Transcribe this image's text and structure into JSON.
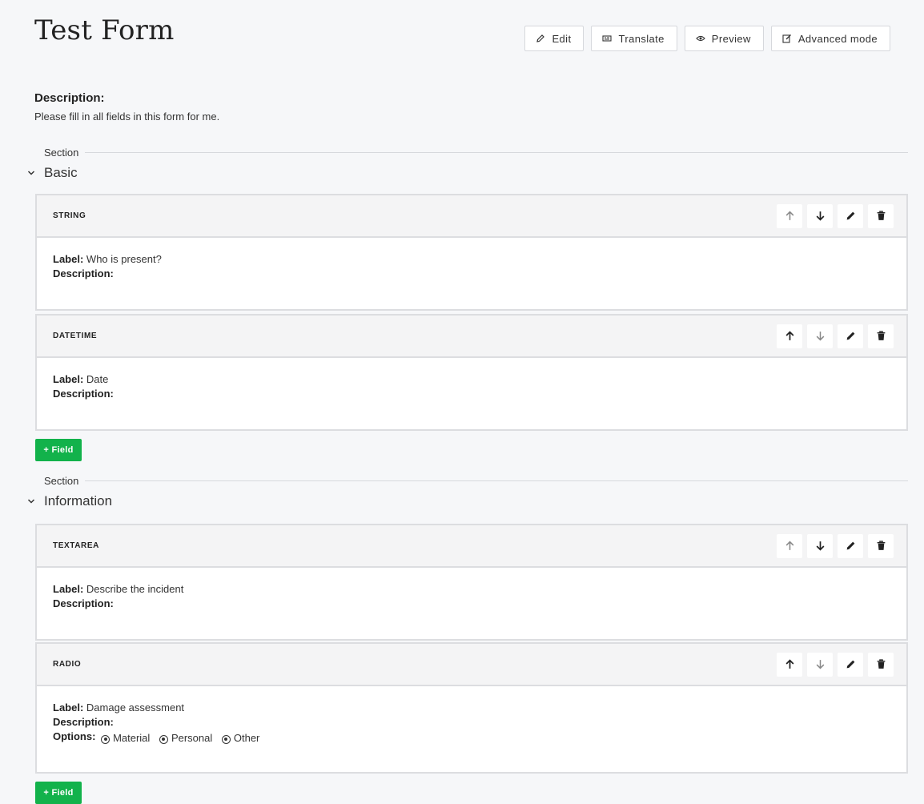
{
  "page": {
    "title": "Test Form",
    "description_heading": "Description:",
    "description_text": "Please fill in all fields in this form for me."
  },
  "toolbar": {
    "edit": "Edit",
    "translate": "Translate",
    "preview": "Preview",
    "advanced": "Advanced mode"
  },
  "labels": {
    "section": "Section",
    "label": "Label:",
    "description": "Description:",
    "options": "Options:",
    "add_field": "+ Field"
  },
  "sections": [
    {
      "name": "Basic",
      "fields": [
        {
          "type": "STRING",
          "label": "Who is present?"
        },
        {
          "type": "DATETIME",
          "label": "Date"
        }
      ]
    },
    {
      "name": "Information",
      "fields": [
        {
          "type": "TEXTAREA",
          "label": "Describe the incident"
        },
        {
          "type": "RADIO",
          "label": "Damage assessment",
          "options": [
            "Material",
            "Personal",
            "Other"
          ]
        }
      ]
    }
  ],
  "colors": {
    "accent_green": "#12b24b",
    "background": "#f6f7f9"
  }
}
